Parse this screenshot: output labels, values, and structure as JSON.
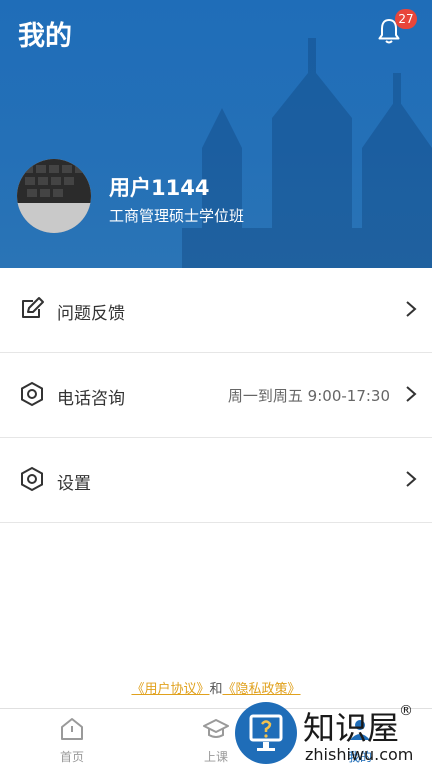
{
  "header": {
    "title": "我的",
    "notifications_count": "27"
  },
  "profile": {
    "name": "用户1144",
    "program": "工商管理硕士学位班"
  },
  "menu": {
    "items": [
      {
        "label": "问题反馈",
        "value": "",
        "icon": "edit-icon"
      },
      {
        "label": "电话咨询",
        "value": "周一到周五 9:00-17:30",
        "icon": "hexagon-icon"
      },
      {
        "label": "设置",
        "value": "",
        "icon": "hexagon-icon"
      }
    ]
  },
  "legal": {
    "user_agreement": "《用户协议》",
    "and": "和",
    "privacy_policy": "《隐私政策》"
  },
  "tabbar": {
    "tabs": [
      {
        "label": "首页",
        "icon": "home-icon"
      },
      {
        "label": "上课",
        "icon": "graduation-cap-icon"
      },
      {
        "label": "我的",
        "icon": "profile-icon"
      }
    ]
  },
  "watermark": {
    "title": "知识屋",
    "registered": "®",
    "url": "zhishiwu.com"
  },
  "colors": {
    "header_blue": "#1f6db8",
    "badge_red": "#e8463b",
    "link_gold": "#e0a11d"
  }
}
